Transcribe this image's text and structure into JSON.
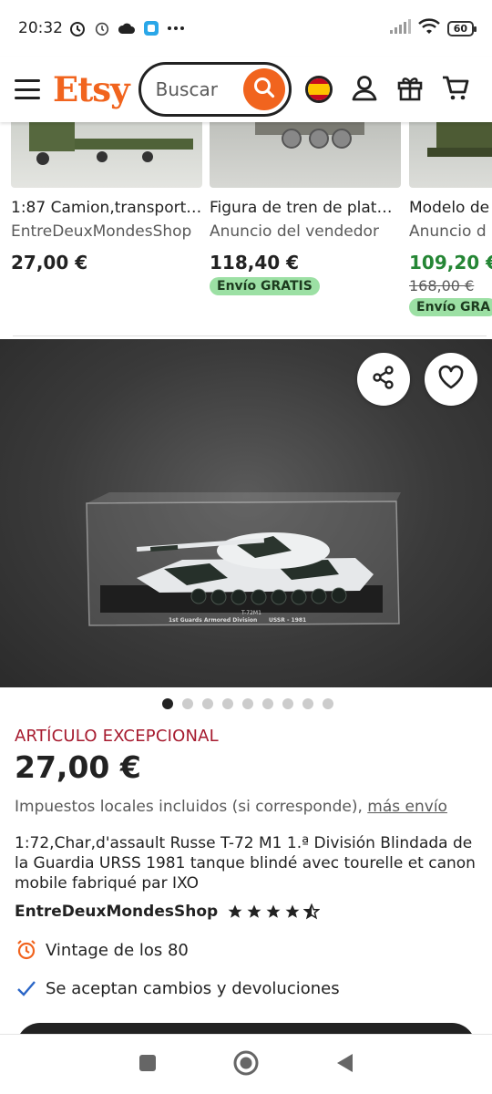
{
  "status": {
    "time": "20:32",
    "battery": "60"
  },
  "header": {
    "logo": "Etsy",
    "search_placeholder": "Buscar"
  },
  "similar": [
    {
      "title": "1:87 Camion,transport…",
      "seller": "EntreDeuxMondesShop",
      "price": "27,00 €"
    },
    {
      "title": "Figura de tren de plat…",
      "seller": "Anuncio del vendedor",
      "price": "118,40 €",
      "badge": "Envío GRATIS"
    },
    {
      "title": "Modelo de",
      "seller": "Anuncio d",
      "price": "109,20 €",
      "original_price": "168,00 €",
      "badge": "Envío GRA"
    }
  ],
  "gallery": {
    "image_count": 9,
    "active_index": 0,
    "caption_model": "T-72M1",
    "caption_division": "1st Guards Armored Division",
    "caption_origin": "USSR - 1981"
  },
  "listing": {
    "star_label": "ARTÍCULO EXCEPCIONAL",
    "price": "27,00 €",
    "taxes": "Impuestos locales incluidos (si corresponde),",
    "shipping_link": "más envío",
    "description": "1:72,Char,d'assault Russe T-72 M1 1.ª División Blindada de la Guardia URSS 1981 tanque blindé avec tourelle et canon mobile fabriqué par IXO",
    "shop_name": "EntreDeuxMondesShop",
    "rating": 4.5,
    "features": [
      {
        "icon": "alarm-clock-icon",
        "text": "Vintage de los 80"
      },
      {
        "icon": "checkmark-icon",
        "text": "Se aceptan cambios y devoluciones"
      }
    ]
  },
  "colors": {
    "brand": "#f1641e",
    "star_seller": "#a61a2e",
    "sale": "#258635",
    "free_shipping_bg": "#9ce0a4"
  }
}
